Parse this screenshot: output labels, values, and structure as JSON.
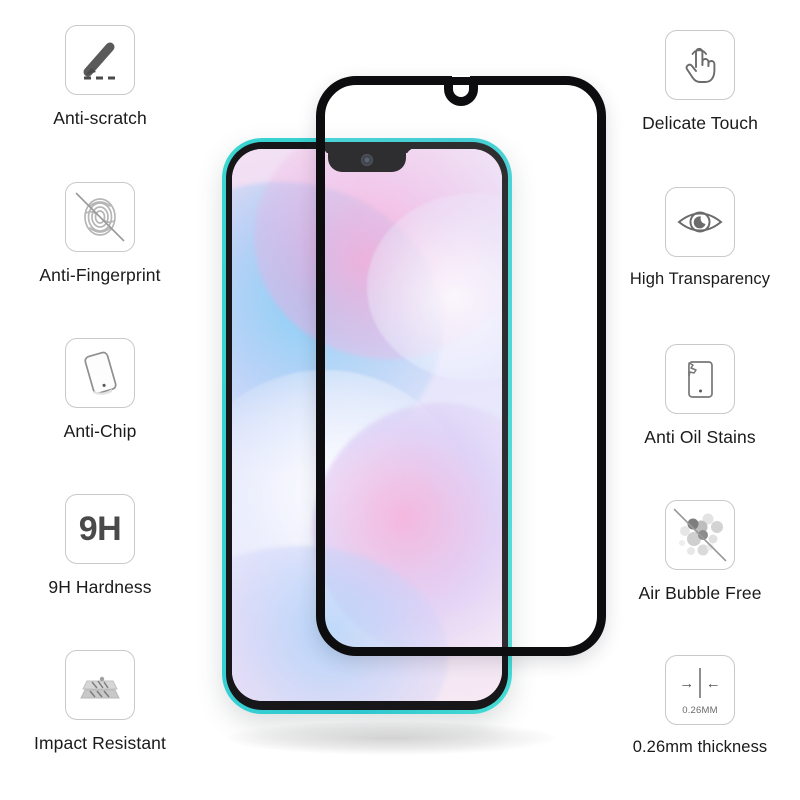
{
  "product": {
    "type": "tempered-glass-screen-protector-infographic",
    "background_color": "#ffffff",
    "phone": {
      "edge_color": "#36cfd2",
      "bezel_color": "#17171a",
      "wallpaper_colors": [
        "#f3e0f3",
        "#e4e2fb",
        "#78cdf5",
        "#fa9fd2"
      ],
      "notch_style": "waterdrop",
      "camera": "front-camera"
    },
    "protector": {
      "frame_color": "#0d0d0f",
      "notch_cutout": "u-shaped"
    }
  },
  "features_left": [
    {
      "label": "Anti-scratch",
      "icon": "pen-scratch-icon"
    },
    {
      "label": "Anti-Fingerprint",
      "icon": "fingerprint-slashed-icon"
    },
    {
      "label": "Anti-Chip",
      "icon": "tilted-phone-chip-icon"
    },
    {
      "label": "9H Hardness",
      "icon": "nine-h-icon",
      "icon_text": "9H"
    },
    {
      "label": "Impact Resistant",
      "icon": "layered-glass-impact-icon"
    }
  ],
  "features_right": [
    {
      "label": "Delicate Touch",
      "icon": "hand-tap-icon"
    },
    {
      "label": "High Transparency",
      "icon": "eye-icon"
    },
    {
      "label": "Anti Oil Stains",
      "icon": "phone-oil-stain-icon"
    },
    {
      "label": "Air Bubble Free",
      "icon": "bubbles-slashed-icon"
    },
    {
      "label": "0.26mm thickness",
      "icon": "thickness-arrows-icon",
      "icon_text": "0.26MM",
      "arrow_left": "→",
      "arrow_right": "←"
    }
  ]
}
